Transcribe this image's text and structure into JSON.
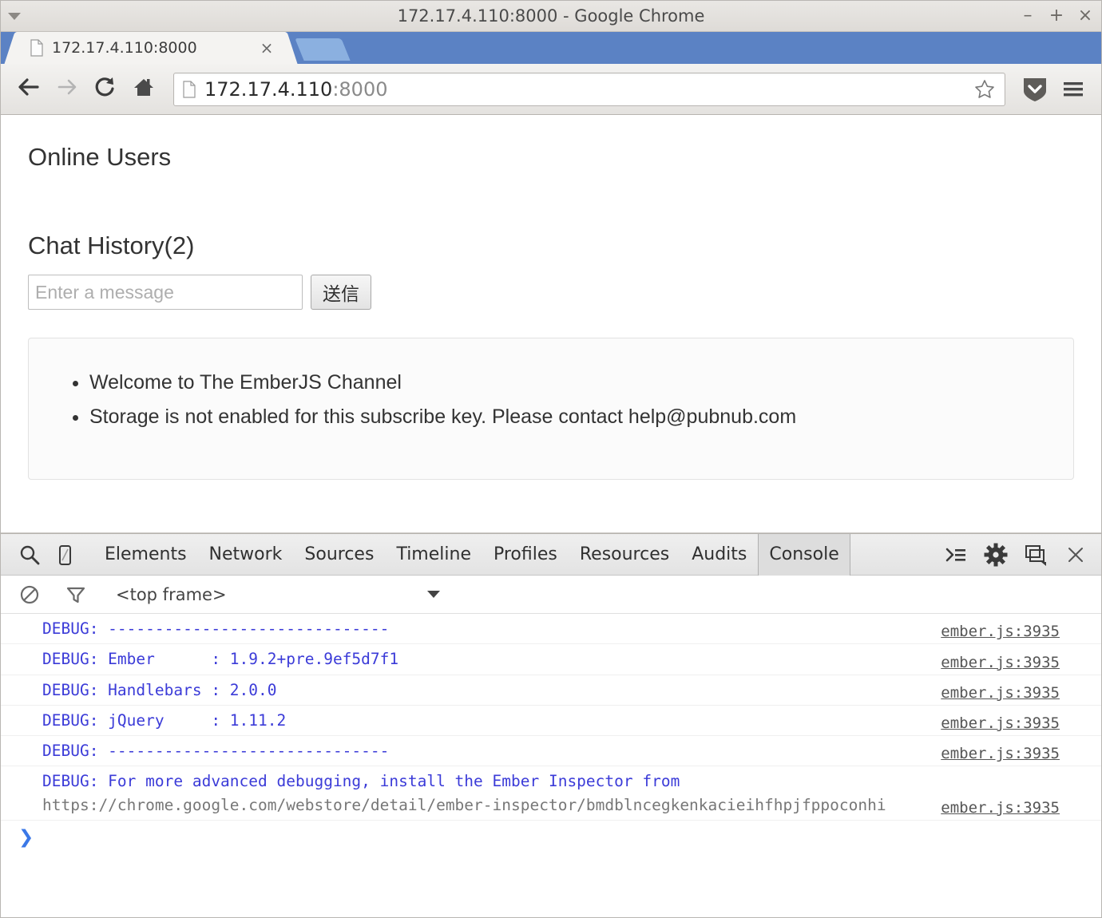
{
  "window": {
    "title": "172.17.4.110:8000 - Google Chrome",
    "menu_arrow_icon": "caret-down-icon",
    "minimize_label": "–",
    "maximize_label": "+",
    "close_label": "×"
  },
  "tabstrip": {
    "tabs": [
      {
        "title": "172.17.4.110:8000",
        "favicon_icon": "page-icon",
        "close_label": "×"
      }
    ],
    "new_tab_icon": "new-tab-icon"
  },
  "toolbar": {
    "back_icon": "arrow-left-icon",
    "forward_icon": "arrow-right-icon",
    "reload_icon": "reload-icon",
    "home_icon": "home-icon",
    "omnibox": {
      "favicon_icon": "page-icon",
      "host": "172.17.4.110",
      "port": ":8000",
      "bookmark_icon": "star-icon"
    },
    "pocket_icon": "pocket-shield-icon",
    "menu_icon": "hamburger-menu-icon"
  },
  "page": {
    "online_users_heading": "Online Users",
    "chat_history_heading": "Chat History(2)",
    "input_placeholder": "Enter a message",
    "input_value": "",
    "send_label": "送信",
    "messages": [
      "Welcome to The EmberJS Channel",
      "Storage is not enabled for this subscribe key. Please contact help@pubnub.com"
    ]
  },
  "devtools": {
    "search_icon": "search-icon",
    "device_icon": "device-toggle-icon",
    "tabs": [
      {
        "label": "Elements",
        "active": false
      },
      {
        "label": "Network",
        "active": false
      },
      {
        "label": "Sources",
        "active": false
      },
      {
        "label": "Timeline",
        "active": false
      },
      {
        "label": "Profiles",
        "active": false
      },
      {
        "label": "Resources",
        "active": false
      },
      {
        "label": "Audits",
        "active": false
      },
      {
        "label": "Console",
        "active": true
      }
    ],
    "right_icons": [
      "console-drawer-icon",
      "settings-gear-icon",
      "dock-side-icon",
      "close-icon"
    ],
    "filterbar": {
      "clear_icon": "clear-console-icon",
      "filter_icon": "filter-funnel-icon",
      "frame_label": "<top frame>",
      "frame_caret_icon": "caret-down-icon"
    },
    "console": {
      "source_link": "ember.js:3935",
      "rows": [
        {
          "text": "DEBUG: ------------------------------",
          "source": "ember.js:3935",
          "multiline": false
        },
        {
          "text": "DEBUG: Ember      : 1.9.2+pre.9ef5d7f1",
          "source": "ember.js:3935",
          "multiline": false
        },
        {
          "text": "DEBUG: Handlebars : 2.0.0",
          "source": "ember.js:3935",
          "multiline": false
        },
        {
          "text": "DEBUG: jQuery     : 1.11.2",
          "source": "ember.js:3935",
          "multiline": false
        },
        {
          "text": "DEBUG: ------------------------------",
          "source": "ember.js:3935",
          "multiline": false
        }
      ],
      "long_row": {
        "text": "DEBUG: For more advanced debugging, install the Ember Inspector from",
        "url": "https://chrome.google.com/webstore/detail/ember-inspector/bmdblncegkenkacieihfhpjfppoconhi",
        "source": "ember.js:3935"
      },
      "prompt_caret": "❯"
    }
  },
  "colors": {
    "tabstrip_blue": "#5b82c4",
    "console_blue": "#3b3bd8",
    "prompt_blue": "#3b78e7"
  }
}
